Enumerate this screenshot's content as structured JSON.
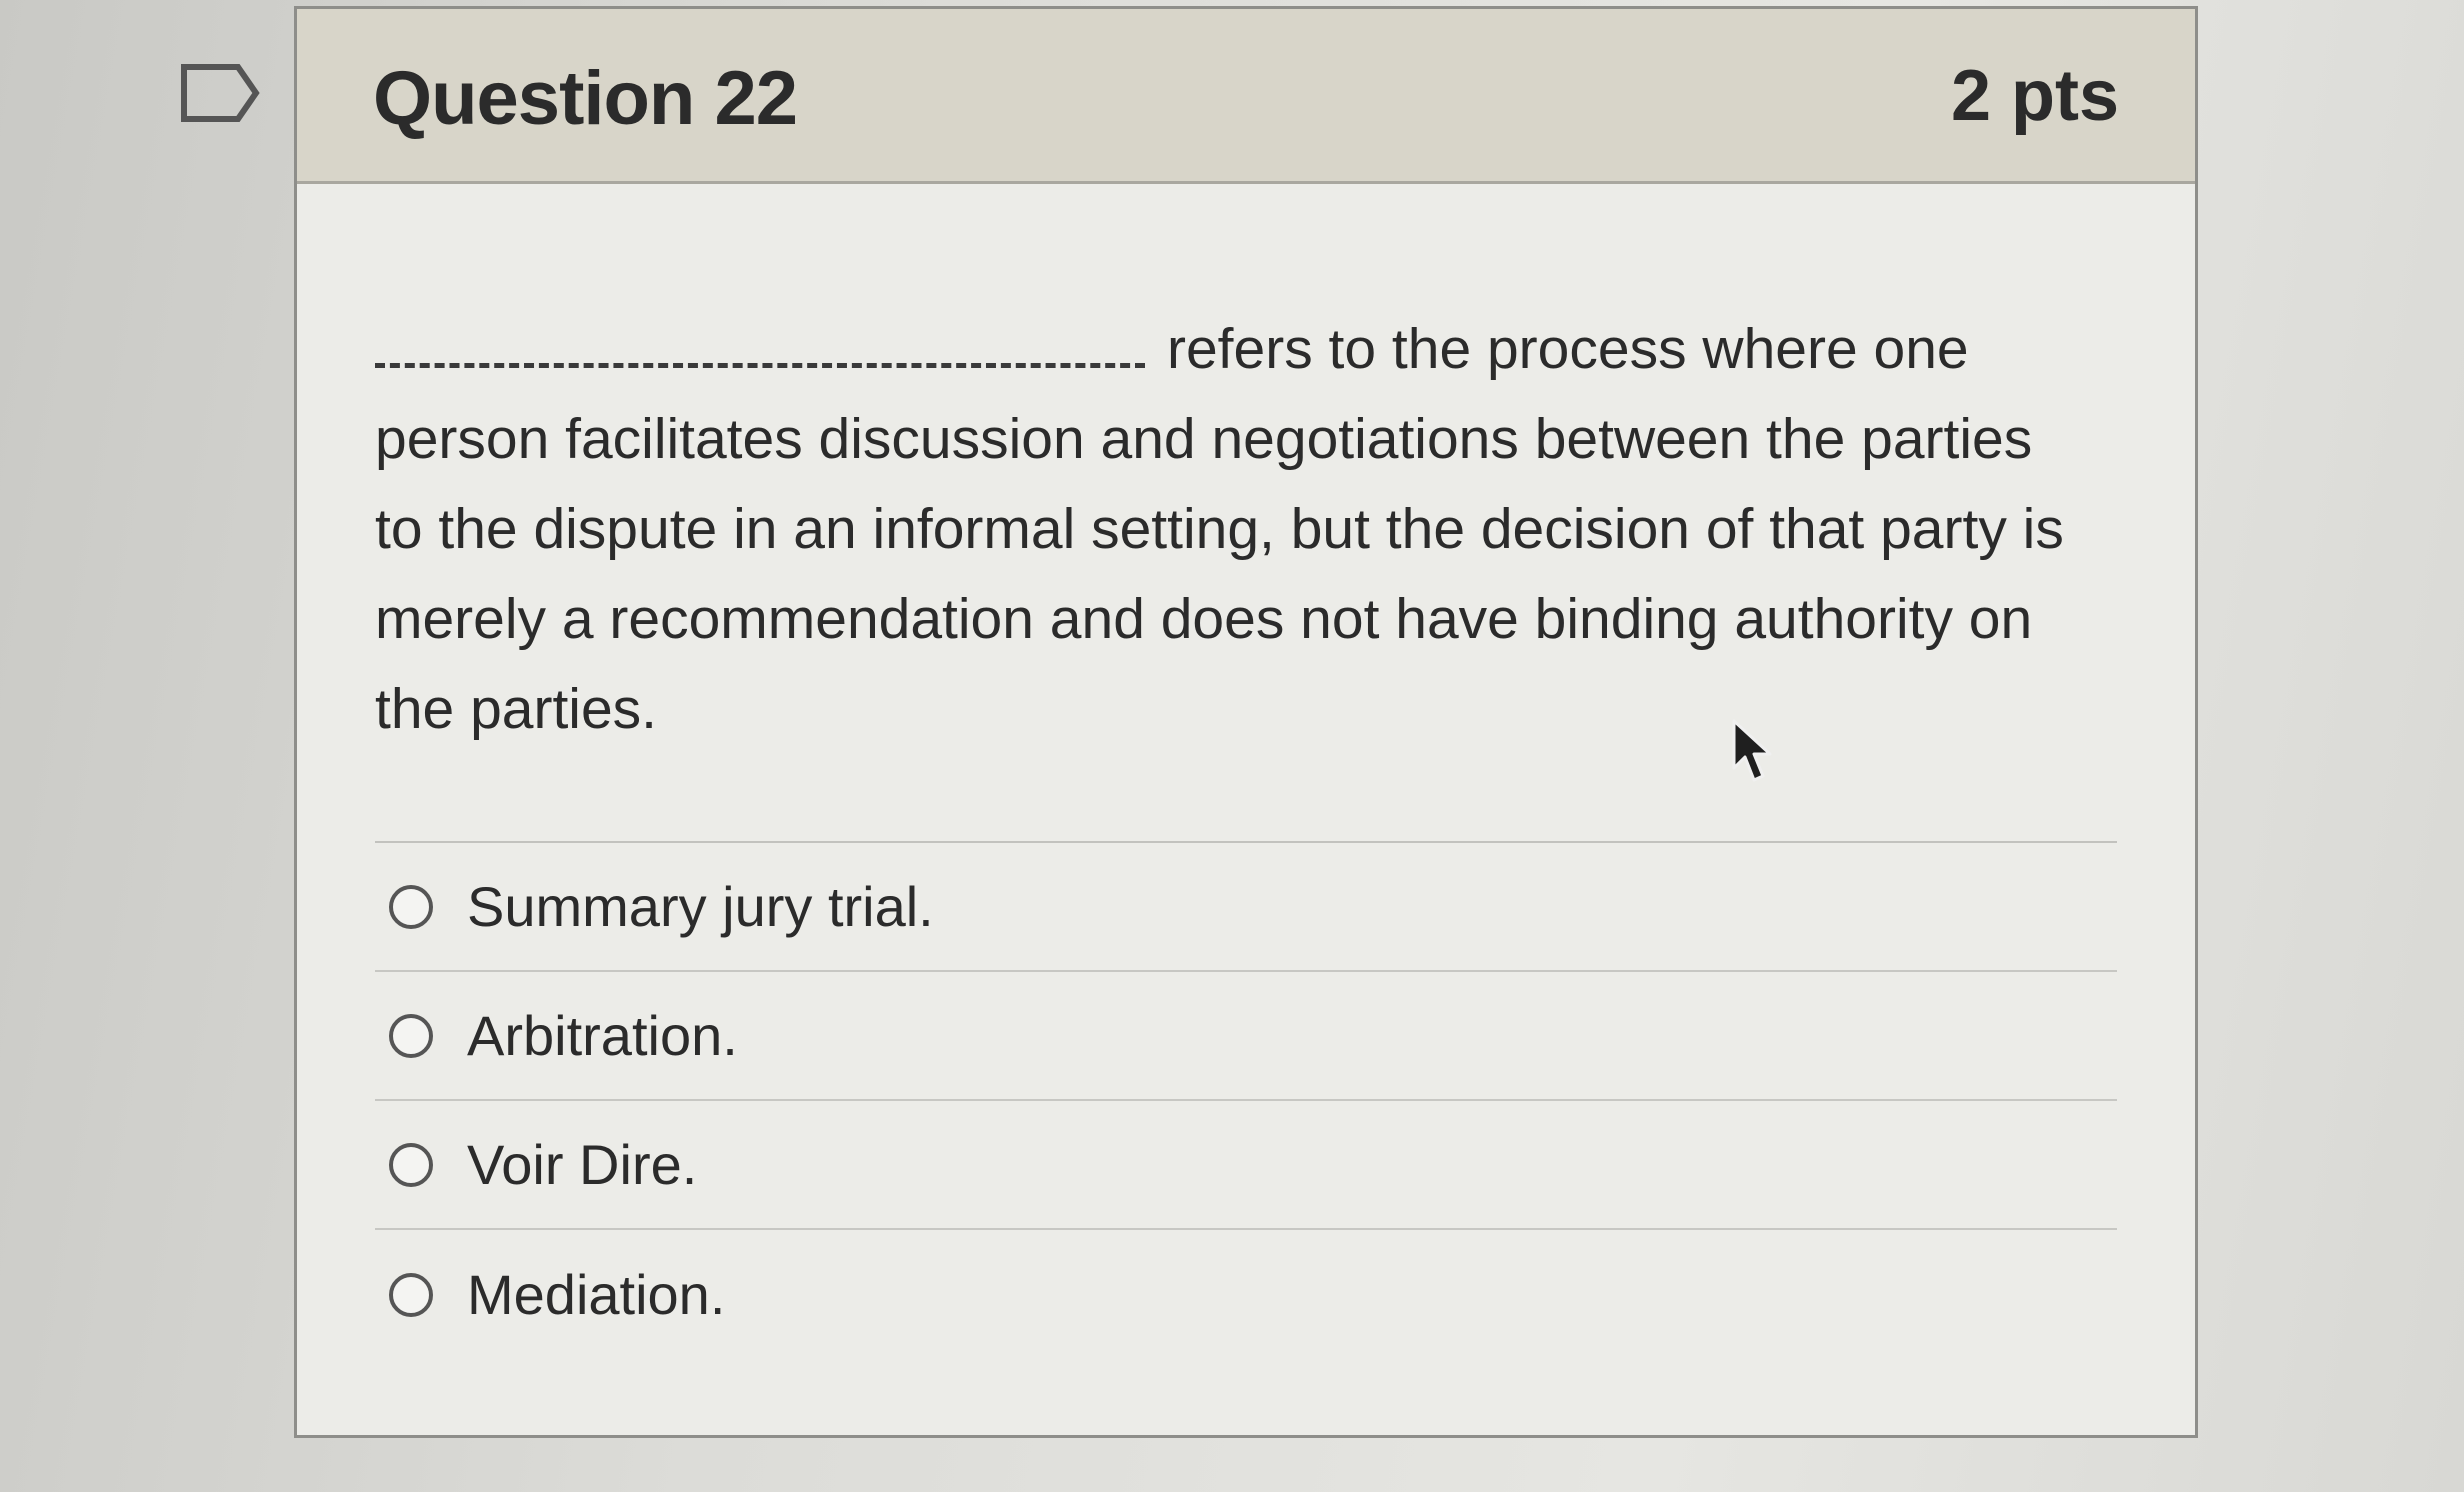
{
  "question": {
    "title": "Question 22",
    "points": "2 pts",
    "text_after_blank": "refers to the process where one person facilitates discussion and negotiations between the parties to the dispute in an informal setting, but the decision of that party is merely a recommendation and does not have binding authority on the parties."
  },
  "answers": [
    {
      "label": "Summary jury trial."
    },
    {
      "label": "Arbitration."
    },
    {
      "label": "Voir Dire."
    },
    {
      "label": "Mediation."
    }
  ],
  "icons": {
    "flag": "flag-icon",
    "radio": "radio-button-icon",
    "cursor": "mouse-cursor-icon"
  },
  "colors": {
    "header_background": "#d8d5c9",
    "card_background": "#ecece8",
    "text": "#2b2b2b",
    "border": "#8e8e8a"
  }
}
